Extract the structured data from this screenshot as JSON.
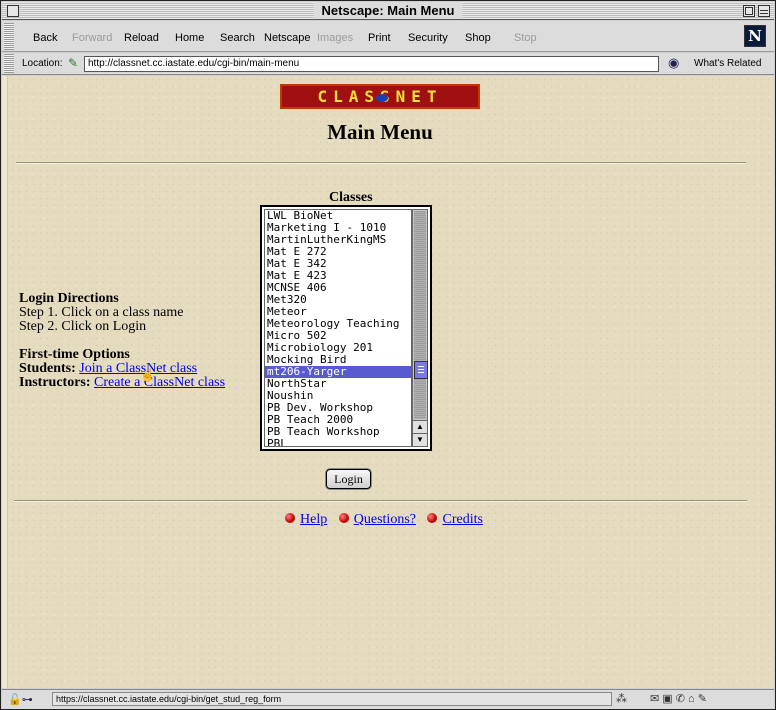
{
  "window": {
    "title": "Netscape: Main Menu"
  },
  "toolbar": {
    "back": "Back",
    "forward": "Forward",
    "reload": "Reload",
    "home": "Home",
    "search": "Search",
    "netscape": "Netscape",
    "images": "Images",
    "print": "Print",
    "security": "Security",
    "shop": "Shop",
    "stop": "Stop",
    "logo": "N"
  },
  "location": {
    "label": "Location:",
    "url": "http://classnet.cc.iastate.edu/cgi-bin/main-menu",
    "related": "What's Related"
  },
  "page": {
    "logo_text": "CLASSNET",
    "heading": "Main Menu",
    "classes_label": "Classes",
    "login_directions_title": "Login Directions",
    "step1": "Step 1. Click on a class name",
    "step2": "Step 2. Click on Login",
    "first_time_title": "First-time Options",
    "students_label": "Students:",
    "students_link": "Join a ClassNet class",
    "instructors_label": "Instructors:",
    "instructors_link": "Create a ClassNet class",
    "login_button": "Login"
  },
  "classes": [
    "LWL BioNet",
    "Marketing I - 1010",
    "MartinLutherKingMS",
    "Mat E 272",
    "Mat E 342",
    "Mat E 423",
    "MCNSE 406",
    "Met320",
    "Meteor",
    "Meteorology Teaching",
    "Micro 502",
    "Microbiology 201",
    "Mocking Bird",
    "mt206-Yarger",
    "NorthStar",
    "Noushin",
    "PB Dev. Workshop",
    "PB Teach 2000",
    "PB Teach Workshop",
    "PBL"
  ],
  "selected_class": "mt206-Yarger",
  "footer": {
    "help": "Help",
    "questions": "Questions?",
    "credits": "Credits"
  },
  "status": {
    "text": "https://classnet.cc.iastate.edu/cgi-bin/get_stud_reg_form"
  }
}
